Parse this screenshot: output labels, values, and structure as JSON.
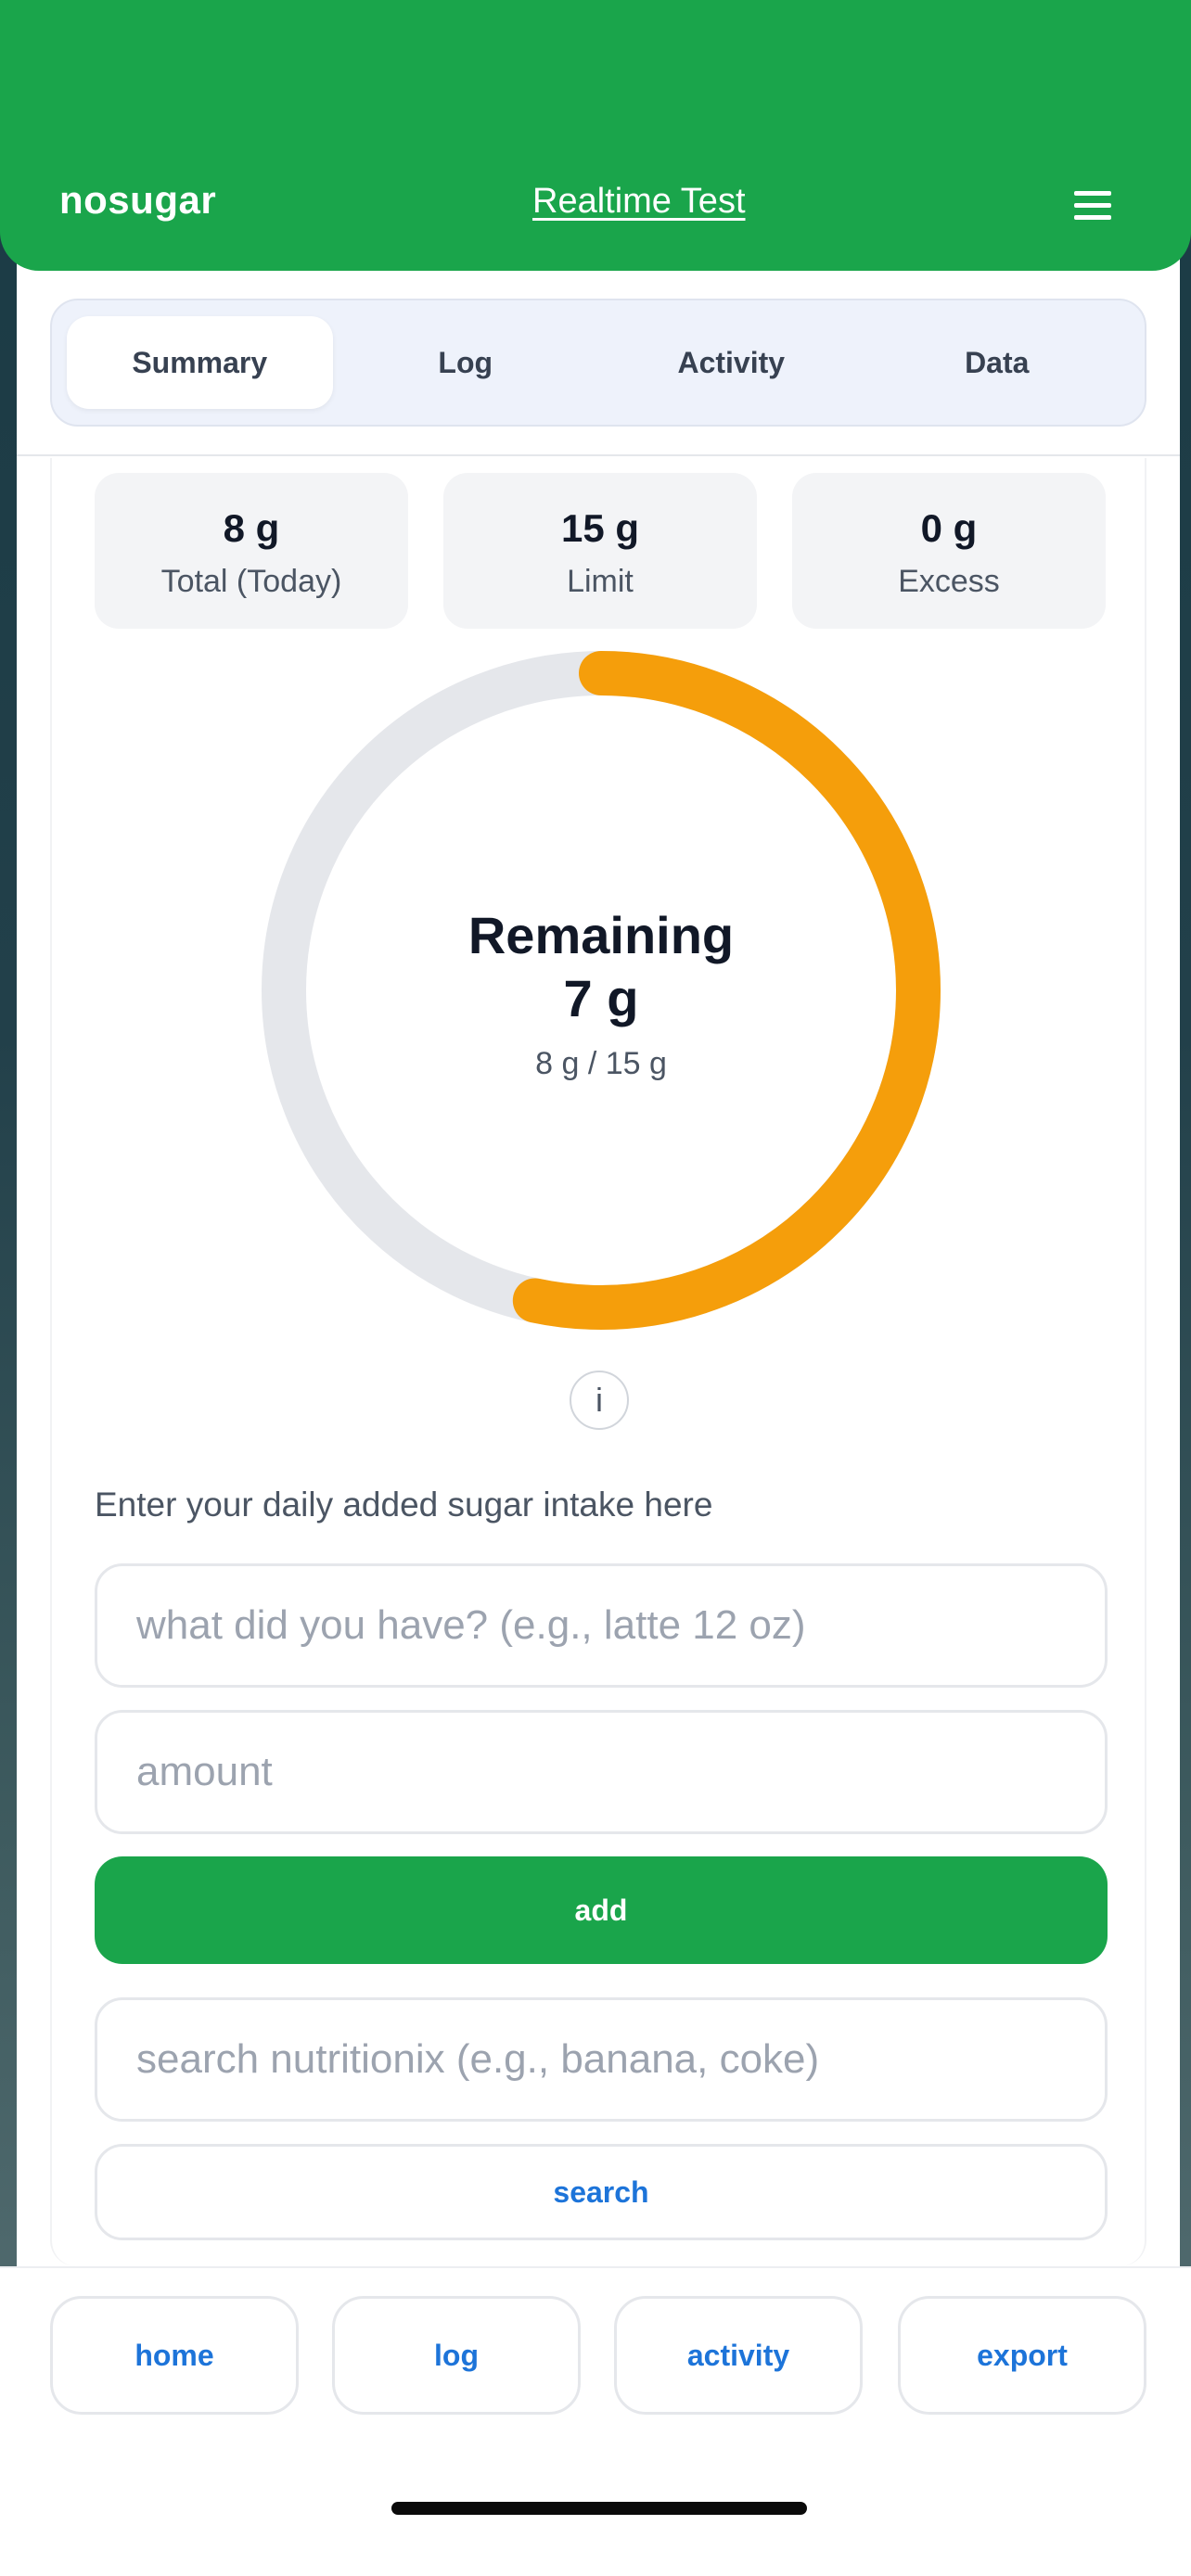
{
  "header": {
    "brand": "nosugar",
    "realtime_link": "Realtime Test",
    "menu_icon": "hamburger-menu-icon"
  },
  "tabs": [
    {
      "label": "Summary",
      "active": true
    },
    {
      "label": "Log",
      "active": false
    },
    {
      "label": "Activity",
      "active": false
    },
    {
      "label": "Data",
      "active": false
    }
  ],
  "stats": [
    {
      "value": "8 g",
      "label": "Total (Today)"
    },
    {
      "value": "15 g",
      "label": "Limit"
    },
    {
      "value": "0 g",
      "label": "Excess"
    }
  ],
  "ring": {
    "title": "Remaining",
    "remaining": "7 g",
    "subtitle": "8 g / 15 g",
    "consumed": 8,
    "limit": 15,
    "progress_color": "#f59e0b",
    "track_color": "#e5e7eb"
  },
  "info_icon": "i",
  "entry": {
    "hint": "Enter your daily added sugar intake here",
    "item_placeholder": "what did you have? (e.g., latte 12 oz)",
    "amount_placeholder": "amount",
    "add_label": "add",
    "search_placeholder": "search nutritionix (e.g., banana, coke)",
    "search_label": "search"
  },
  "bottom_nav": [
    {
      "label": "home"
    },
    {
      "label": "log"
    },
    {
      "label": "activity"
    },
    {
      "label": "export"
    }
  ],
  "colors": {
    "brand_green": "#1aa54b",
    "link_blue": "#1d74d9"
  }
}
